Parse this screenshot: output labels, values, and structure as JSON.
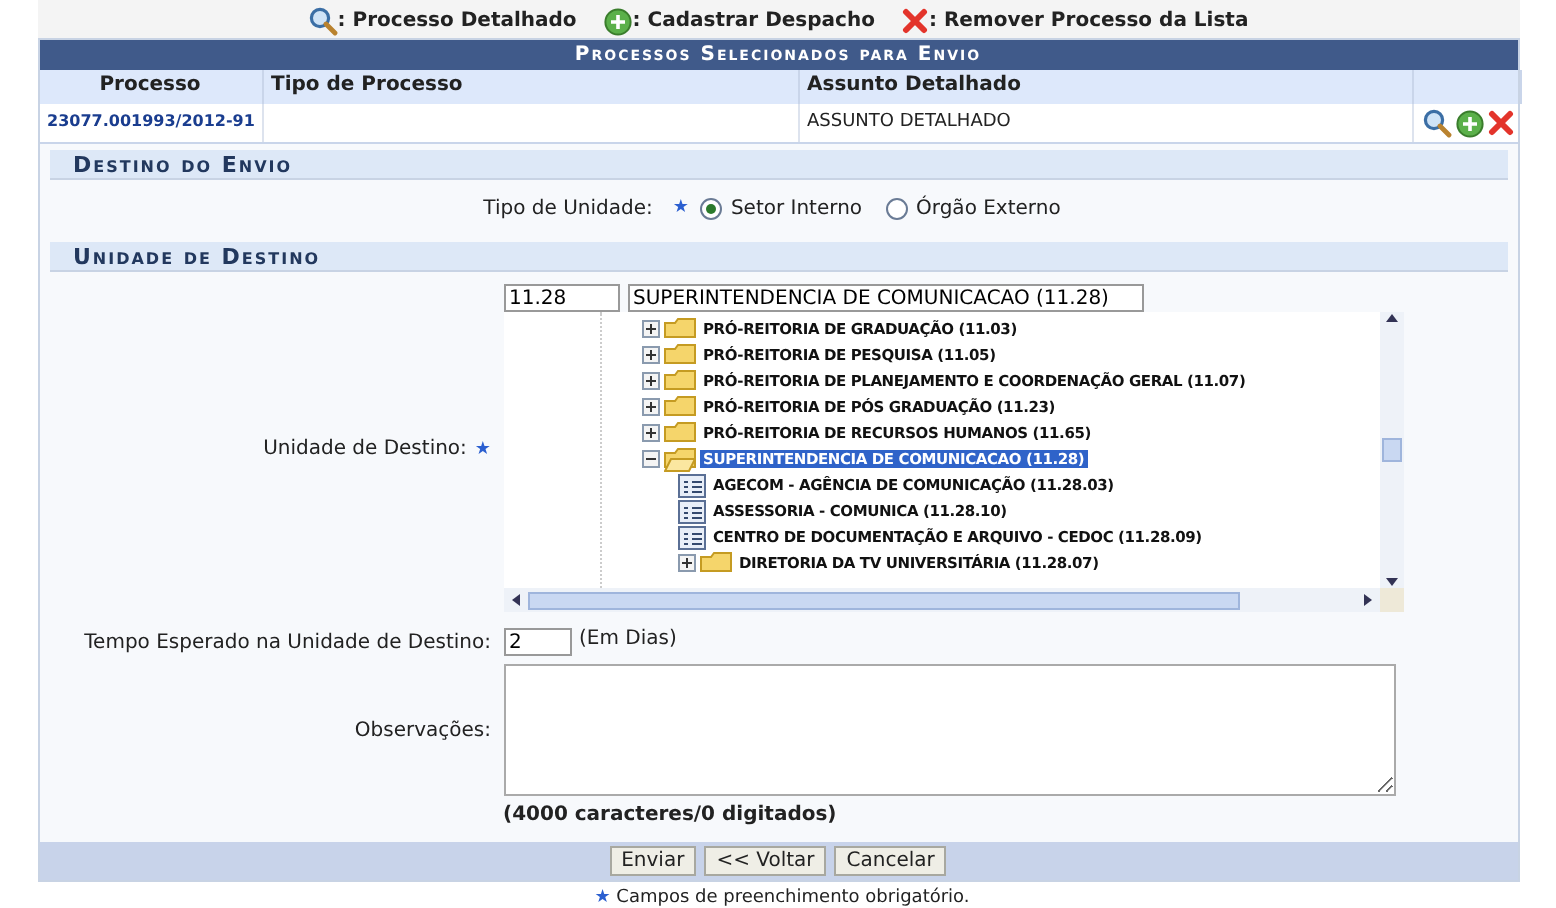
{
  "legend": [
    {
      "kind": "search",
      "text": ": Processo Detalhado"
    },
    {
      "kind": "add",
      "text": ": Cadastrar Despacho"
    },
    {
      "kind": "remove",
      "text": ": Remover Processo da Lista"
    }
  ],
  "table": {
    "title": "Processos Selecionados para Envio",
    "columns": [
      "Processo",
      "Tipo de Processo",
      "Assunto Detalhado"
    ],
    "rows": [
      {
        "processo": "23077.001993/2012-91",
        "tipo": "",
        "assunto": "ASSUNTO DETALHADO"
      }
    ]
  },
  "destino": {
    "title": "Destino do Envio",
    "label": "Tipo de Unidade:",
    "required": "★",
    "options": [
      {
        "label": "Setor Interno",
        "selected": true
      },
      {
        "label": "Órgão Externo",
        "selected": false
      }
    ]
  },
  "unidade": {
    "title": "Unidade de Destino",
    "label": "Unidade de Destino:",
    "required": "★",
    "code": "11.28",
    "name": "SUPERINTENDENCIA DE COMUNICACAO (11.28)",
    "tree": [
      {
        "kind": "folder",
        "label": "PRÓ-REITORIA DE GRADUAÇÃO (11.03)",
        "expanded": false,
        "selected": false
      },
      {
        "kind": "folder",
        "label": "PRÓ-REITORIA DE PESQUISA (11.05)",
        "expanded": false,
        "selected": false
      },
      {
        "kind": "folder",
        "label": "PRÓ-REITORIA DE PLANEJAMENTO E COORDENAÇÃO GERAL (11.07)",
        "expanded": false,
        "selected": false
      },
      {
        "kind": "folder",
        "label": "PRÓ-REITORIA DE PÓS GRADUAÇÃO (11.23)",
        "expanded": false,
        "selected": false
      },
      {
        "kind": "folder",
        "label": "PRÓ-REITORIA DE RECURSOS HUMANOS (11.65)",
        "expanded": false,
        "selected": false
      },
      {
        "kind": "folder",
        "label": "SUPERINTENDENCIA DE COMUNICACAO (11.28)",
        "expanded": true,
        "selected": true,
        "children": [
          {
            "kind": "leaf",
            "label": "AGECOM - AGÊNCIA DE COMUNICAÇÃO (11.28.03)",
            "selected": false
          },
          {
            "kind": "leaf",
            "label": "ASSESSORIA - COMUNICA (11.28.10)",
            "selected": false
          },
          {
            "kind": "leaf",
            "label": "CENTRO DE DOCUMENTAÇÃO E ARQUIVO - CEDOC (11.28.09)",
            "selected": false
          },
          {
            "kind": "folder",
            "label": "DIRETORIA DA TV UNIVERSITÁRIA (11.28.07)",
            "expanded": false,
            "selected": false
          }
        ]
      }
    ]
  },
  "tempo": {
    "label": "Tempo Esperado na Unidade de Destino:",
    "value": "2",
    "unit": "(Em Dias)"
  },
  "observacoes": {
    "label": "Observações:",
    "counter": "(4000 caracteres/0 digitados)"
  },
  "buttons": [
    "Enviar",
    "<< Voltar",
    "Cancelar"
  ],
  "note": {
    "star": "★",
    "text": "Campos de preenchimento obrigatório."
  }
}
